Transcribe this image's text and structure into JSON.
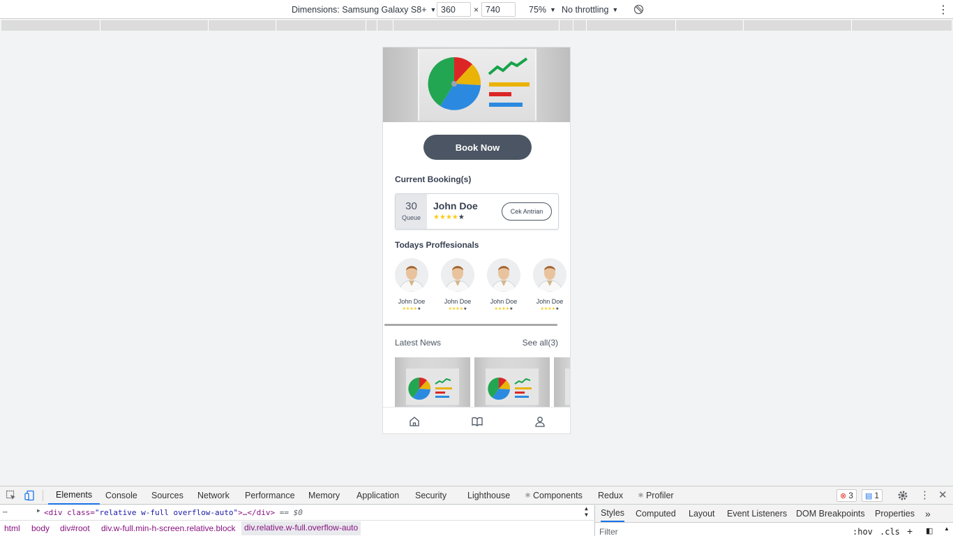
{
  "device_toolbar": {
    "dimensions_label": "Dimensions: Samsung Galaxy S8+",
    "width": "360",
    "height": "740",
    "times": "×",
    "zoom": "75%",
    "throttling": "No throttling"
  },
  "app": {
    "book_button": "Book Now",
    "current_bookings_title": "Current Booking(s)",
    "booking": {
      "queue_number": "30",
      "queue_label": "Queue",
      "name": "John Doe",
      "rating": 4,
      "rating_max": 5,
      "action_label": "Cek Antrian"
    },
    "professionals_title": "Todays Proffesionals",
    "professionals": [
      {
        "name": "John Doe",
        "rating": 4
      },
      {
        "name": "John Doe",
        "rating": 4
      },
      {
        "name": "John Doe",
        "rating": 4
      },
      {
        "name": "John Doe",
        "rating": 4
      }
    ],
    "news_title": "Latest News",
    "see_all": "See all(3)",
    "nav": [
      "home-icon",
      "book-icon",
      "user-icon"
    ],
    "colors": {
      "primary_button": "#4b5563",
      "star": "#facc15"
    }
  },
  "devtools": {
    "tabs": [
      "Elements",
      "Console",
      "Sources",
      "Network",
      "Performance",
      "Memory",
      "Application",
      "Security",
      "Lighthouse",
      "Components",
      "Redux",
      "Profiler"
    ],
    "active_tab": "Elements",
    "error_count": "3",
    "message_count": "1",
    "dom_line": {
      "open": "<div class=",
      "class_value": "\"relative w-full overflow-auto\"",
      "close": ">…</div>",
      "eq": "== $0"
    },
    "breadcrumbs": [
      "html",
      "body",
      "div#root",
      "div.w-full.min-h-screen.relative.block",
      "div.relative.w-full.overflow-auto"
    ],
    "side_tabs": [
      "Styles",
      "Computed",
      "Layout",
      "Event Listeners",
      "DOM Breakpoints",
      "Properties"
    ],
    "filter_placeholder": "Filter",
    "hov": ":hov",
    "cls": ".cls"
  }
}
